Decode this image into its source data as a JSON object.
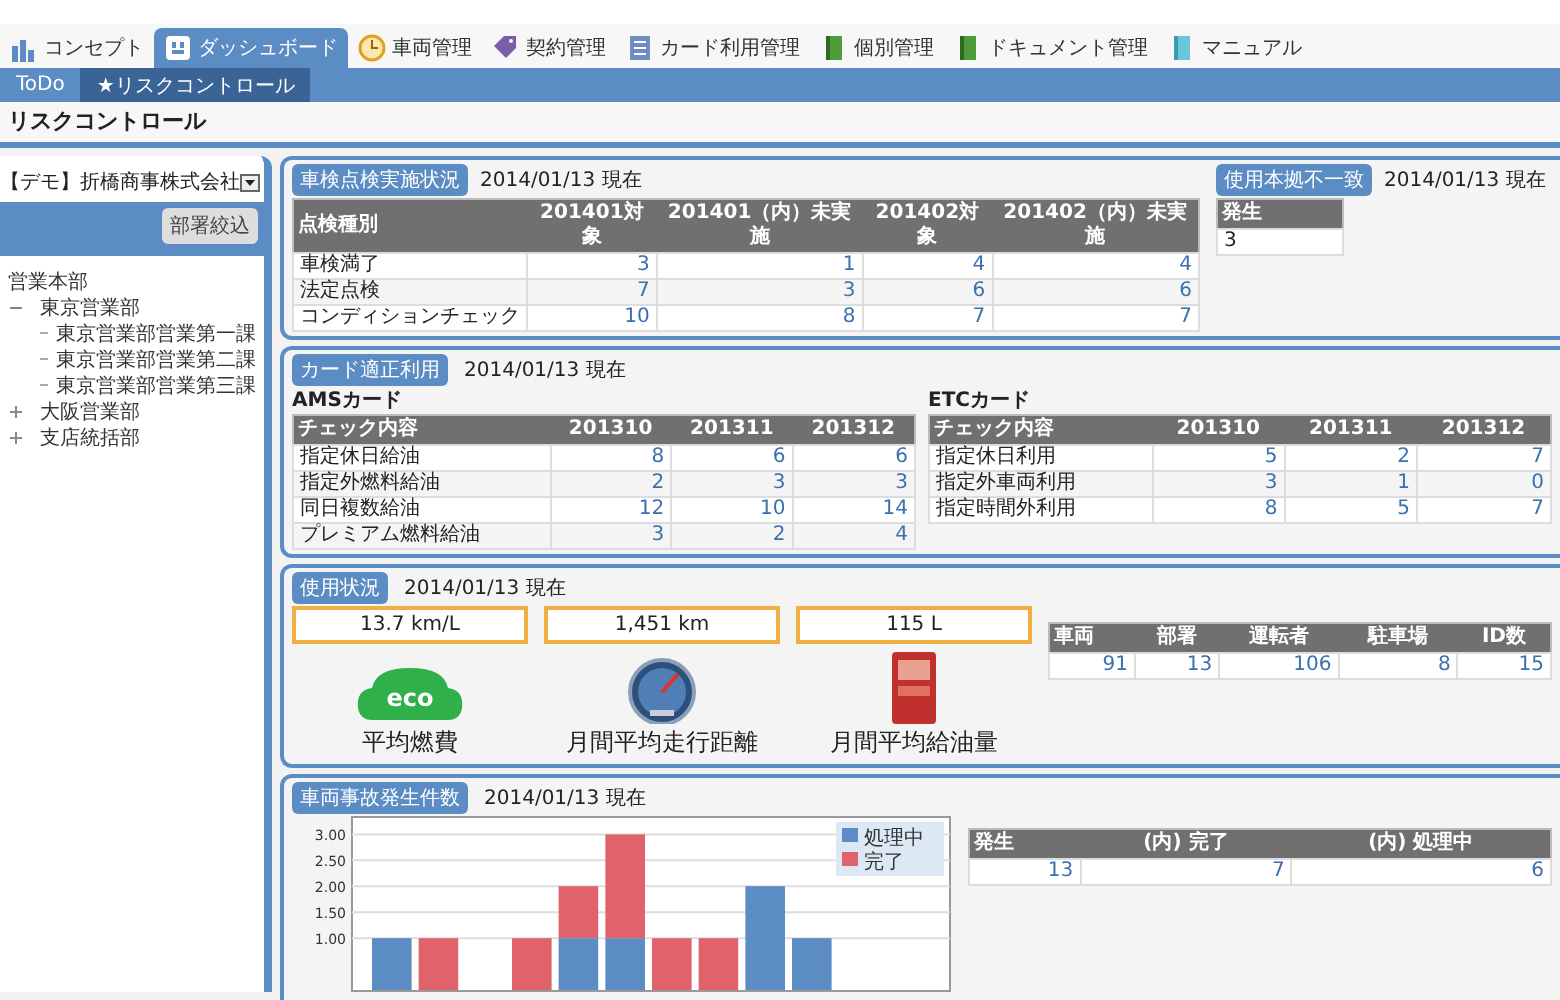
{
  "nav_tabs": [
    {
      "label": "コンセプト",
      "selected": false
    },
    {
      "label": "ダッシュボード",
      "selected": true
    },
    {
      "label": "車両管理",
      "selected": false
    },
    {
      "label": "契約管理",
      "selected": false
    },
    {
      "label": "カード利用管理",
      "selected": false
    },
    {
      "label": "個別管理",
      "selected": false
    },
    {
      "label": "ドキュメント管理",
      "selected": false
    },
    {
      "label": "マニュアル",
      "selected": false
    }
  ],
  "sub_tabs": [
    {
      "label": "ToDo",
      "selected": false
    },
    {
      "label": "★リスクコントロール",
      "selected": true
    }
  ],
  "page_title": "リスクコントロール",
  "sidebar": {
    "company_select": "【デモ】折橋商事株式会社",
    "filter_button": "部署絞込",
    "tree": [
      {
        "label": "営業本部",
        "expanded": true,
        "children": [
          {
            "label": "東京営業部",
            "expanded": true,
            "children": [
              {
                "label": "東京営業部営業第一課"
              },
              {
                "label": "東京営業部営業第二課"
              },
              {
                "label": "東京営業部営業第三課"
              }
            ]
          },
          {
            "label": "大阪営業部",
            "expanded": false
          },
          {
            "label": "支店統括部",
            "expanded": false
          }
        ]
      }
    ]
  },
  "inspection": {
    "badge": "車検点検実施状況",
    "date": "2014/01/13 現在",
    "columns": [
      "点検種別",
      "201401対象",
      "201401（内）未実施",
      "201402対象",
      "201402（内）未実施"
    ],
    "rows": [
      [
        "車検満了",
        "3",
        "1",
        "4",
        "4"
      ],
      [
        "法定点検",
        "7",
        "3",
        "6",
        "6"
      ],
      [
        "コンディションチェック",
        "10",
        "8",
        "7",
        "7"
      ]
    ]
  },
  "base_mismatch": {
    "badge": "使用本拠不一致",
    "date": "2014/01/13 現在",
    "columns": [
      "発生"
    ],
    "rows": [
      [
        "3"
      ]
    ]
  },
  "card_usage": {
    "badge": "カード適正利用",
    "date": "2014/01/13 現在",
    "ams": {
      "title": "AMSカード",
      "columns": [
        "チェック内容",
        "201310",
        "201311",
        "201312"
      ],
      "rows": [
        [
          "指定休日給油",
          "8",
          "6",
          "6"
        ],
        [
          "指定外燃料給油",
          "2",
          "3",
          "3"
        ],
        [
          "同日複数給油",
          "12",
          "10",
          "14"
        ],
        [
          "プレミアム燃料給油",
          "3",
          "2",
          "4"
        ]
      ]
    },
    "etc": {
      "title": "ETCカード",
      "columns": [
        "チェック内容",
        "201310",
        "201311",
        "201312"
      ],
      "rows": [
        [
          "指定休日利用",
          "5",
          "2",
          "7"
        ],
        [
          "指定外車両利用",
          "3",
          "1",
          "0"
        ],
        [
          "指定時間外利用",
          "8",
          "5",
          "7"
        ]
      ]
    }
  },
  "usage": {
    "badge": "使用状況",
    "date": "2014/01/13 現在",
    "metrics": [
      {
        "value": "13.7 km/L",
        "label": "平均燃費",
        "icon_text": "eco"
      },
      {
        "value": "1,451 km",
        "label": "月間平均走行距離"
      },
      {
        "value": "115 L",
        "label": "月間平均給油量"
      }
    ],
    "columns": [
      "車両",
      "部署",
      "運転者",
      "駐車場",
      "ID数"
    ],
    "rows": [
      [
        "91",
        "13",
        "106",
        "8",
        "15"
      ]
    ]
  },
  "accidents": {
    "badge": "車両事故発生件数",
    "date": "2014/01/13 現在",
    "chart_data": {
      "type": "bar",
      "stacked": true,
      "grid": true,
      "legend": "top-right",
      "ylim": [
        0,
        3.2
      ],
      "yticks": [
        {
          "value": 1,
          "label": "1.00"
        },
        {
          "value": 1.5,
          "label": "1.50"
        },
        {
          "value": 2,
          "label": "2.00"
        },
        {
          "value": 2.5,
          "label": "2.50"
        },
        {
          "value": 3,
          "label": "3.00"
        }
      ],
      "series": [
        {
          "name": "処理中",
          "color": "#5b8cc4",
          "values": [
            1,
            0,
            0,
            0,
            1,
            1,
            0,
            0,
            2,
            1,
            0,
            0
          ]
        },
        {
          "name": "完了",
          "color": "#e0626b",
          "values": [
            0,
            1,
            0,
            1,
            1,
            2,
            1,
            1,
            0,
            0,
            0,
            0
          ]
        }
      ]
    },
    "columns": [
      "発生",
      "(内) 完了",
      "(内) 処理中"
    ],
    "rows": [
      [
        "13",
        "7",
        "6"
      ]
    ]
  }
}
